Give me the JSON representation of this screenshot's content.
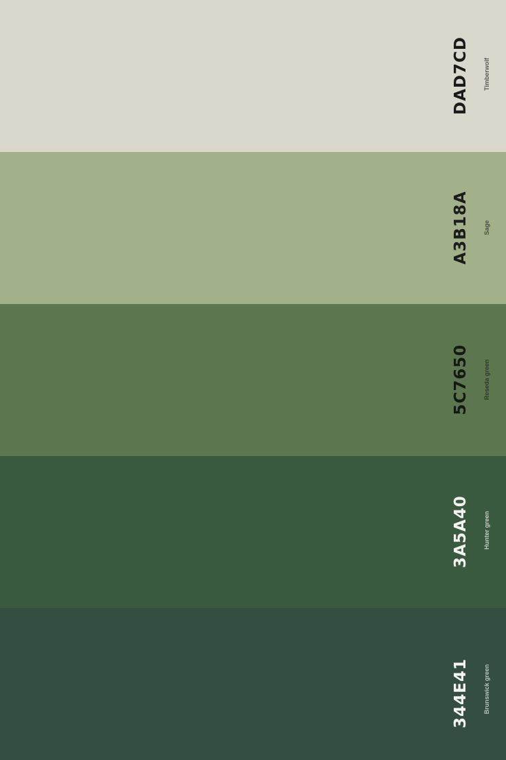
{
  "swatches": [
    {
      "hex": "DAD7CD",
      "name": "Timberwolf",
      "color": "#DAD7CD"
    },
    {
      "hex": "A3B18A",
      "name": "Sage",
      "color": "#A3B18A"
    },
    {
      "hex": "5C7650",
      "name": "Reseda green",
      "color": "#5C7650"
    },
    {
      "hex": "3A5A40",
      "name": "Hunter green",
      "color": "#3A5A40"
    },
    {
      "hex": "344E41",
      "name": "Brunswick green",
      "color": "#344E41"
    }
  ]
}
